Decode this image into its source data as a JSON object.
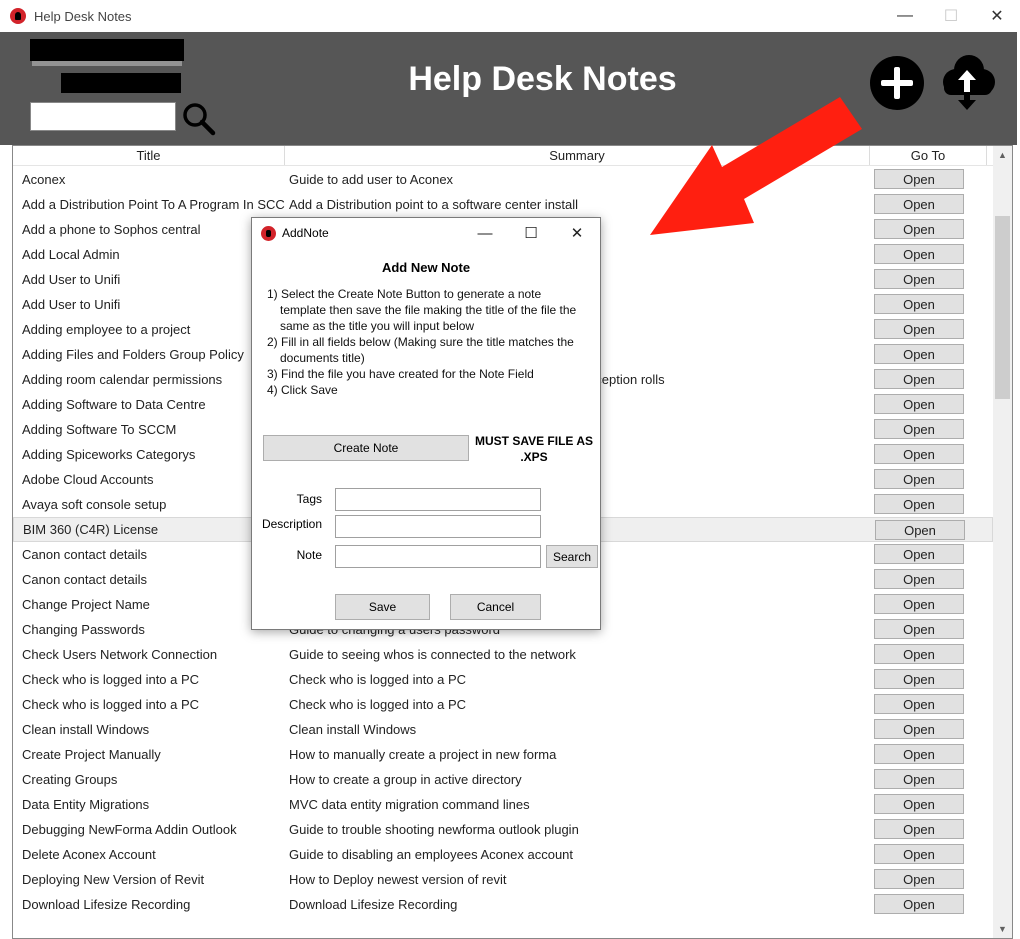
{
  "window": {
    "title": "Help Desk Notes",
    "minimize": "—",
    "maximize": "☐",
    "close": "✕"
  },
  "header": {
    "heading": "Help Desk Notes",
    "search_value": "",
    "accent_color": "#565656"
  },
  "grid": {
    "columns": [
      "Title",
      "Summary",
      "Go To"
    ],
    "open_label": "Open",
    "rows": [
      {
        "title": "Aconex",
        "summary": "Guide to add user to Aconex"
      },
      {
        "title": "Add a Distribution Point To A Program In SCCM",
        "summary": "Add a Distribution point to a software center install"
      },
      {
        "title": "Add a phone to Sophos central",
        "summary": ""
      },
      {
        "title": "Add Local Admin",
        "summary": ""
      },
      {
        "title": "Add User to Unifi",
        "summary": ""
      },
      {
        "title": "Add User to Unifi",
        "summary": ""
      },
      {
        "title": "Adding employee to a project",
        "summary": ""
      },
      {
        "title": "Adding Files and Folders Group Policy",
        "summary": ""
      },
      {
        "title": "Adding room calendar permissions",
        "summary": "                                                            Generally for reception rolls"
      },
      {
        "title": "Adding Software to Data Centre",
        "summary": ""
      },
      {
        "title": "Adding Software To SCCM",
        "summary": ""
      },
      {
        "title": "Adding Spiceworks Categorys",
        "summary": ""
      },
      {
        "title": "Adobe Cloud Accounts",
        "summary": ""
      },
      {
        "title": "Avaya soft console setup",
        "summary": ""
      },
      {
        "title": "BIM 360 (C4R) License",
        "summary": "",
        "selected": true
      },
      {
        "title": "Canon contact details",
        "summary": ""
      },
      {
        "title": "Canon contact details",
        "summary": ""
      },
      {
        "title": "Change Project Name",
        "summary": ""
      },
      {
        "title": "Changing Passwords",
        "summary": "Guide to changing a users password"
      },
      {
        "title": "Check Users Network Connection",
        "summary": "Guide to seeing whos is connected to the network"
      },
      {
        "title": "Check who is logged into a PC",
        "summary": "Check who is logged into a PC"
      },
      {
        "title": "Check who is logged into a PC",
        "summary": "Check who is logged into a PC"
      },
      {
        "title": "Clean install Windows",
        "summary": "Clean install Windows"
      },
      {
        "title": "Create Project Manually",
        "summary": "How to manually create a project in new forma"
      },
      {
        "title": "Creating Groups",
        "summary": "How to create a group in active directory"
      },
      {
        "title": "Data Entity Migrations",
        "summary": "MVC data entity migration command lines"
      },
      {
        "title": "Debugging NewForma Addin Outlook",
        "summary": "Guide to trouble shooting newforma outlook plugin"
      },
      {
        "title": "Delete Aconex Account",
        "summary": "Guide to disabling an employees Aconex account"
      },
      {
        "title": "Deploying New Version of Revit",
        "summary": "How to Deploy newest version of revit"
      },
      {
        "title": "Download Lifesize Recording",
        "summary": "Download Lifesize Recording"
      }
    ]
  },
  "dialog": {
    "title": "AddNote",
    "heading": "Add New Note",
    "steps": [
      "1) Select the Create Note Button to generate a note template then save the file making the title of the file the same as the title you will input below",
      "2) Fill in all fields below (Making sure the title matches the documents title)",
      "3) Find the file you have created for the Note Field",
      "4) Click Save"
    ],
    "create_note_label": "Create Note",
    "must_save_line1": "MUST SAVE FILE AS",
    "must_save_line2": ".XPS",
    "tags_label": "Tags",
    "description_label": "Description",
    "note_label": "Note",
    "tags_value": "",
    "description_value": "",
    "note_value": "",
    "search_label": "Search",
    "save_label": "Save",
    "cancel_label": "Cancel"
  },
  "colors": {
    "arrow": "#ff1f10",
    "brand_red": "#d2232a",
    "button_face": "#e1e1e1"
  }
}
